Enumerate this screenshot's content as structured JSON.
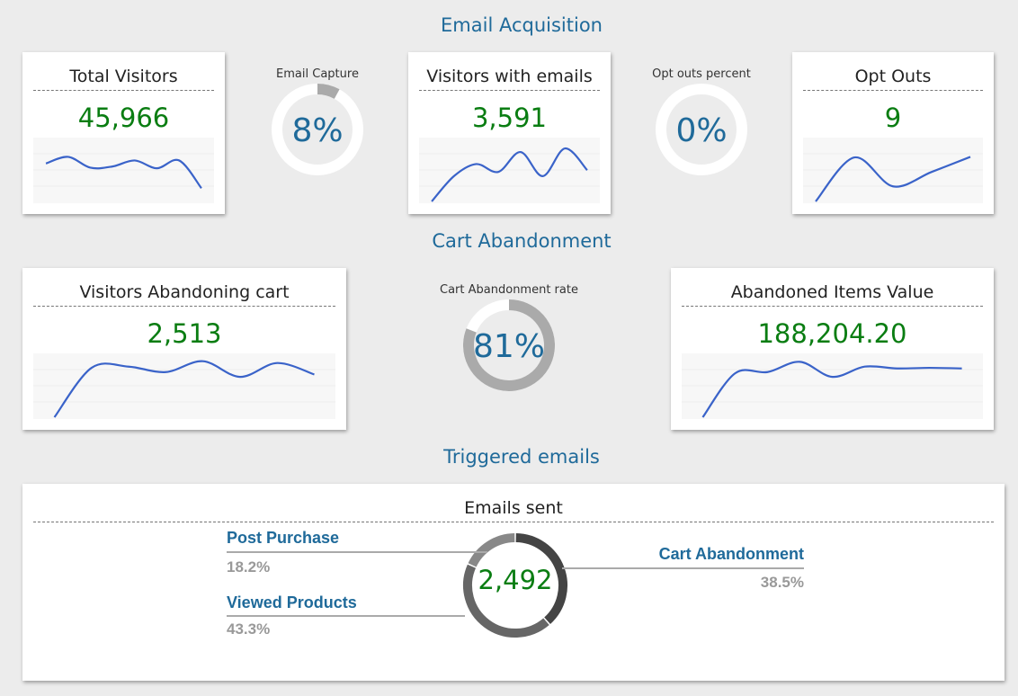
{
  "sections": {
    "email": "Email Acquisition",
    "cart": "Cart Abandonment",
    "triggered": "Triggered emails"
  },
  "cards": [
    {
      "title": "Total Visitors",
      "value": "45,966",
      "sparkline": [
        63,
        74,
        56,
        58,
        68,
        55,
        68,
        22
      ]
    },
    {
      "title": "Visitors with emails",
      "value": "3,591",
      "sparkline": [
        0,
        42,
        62,
        49,
        82,
        42,
        88,
        52
      ]
    },
    {
      "title": "Opt Outs",
      "value": "9",
      "sparkline": [
        0,
        73,
        25,
        49,
        74
      ]
    },
    {
      "title": "Visitors Abandoning cart",
      "value": "2,513",
      "sparkline": [
        0,
        82,
        84,
        75,
        93,
        67,
        90,
        71
      ]
    },
    {
      "title": "Abandoned Items Value",
      "value": "188,204.20",
      "sparkline": [
        0,
        73,
        75,
        92,
        67,
        84,
        81,
        82,
        81
      ]
    }
  ],
  "gauges": [
    {
      "label": "Email Capture",
      "value": "8%",
      "percent": 8
    },
    {
      "label": "Opt outs percent",
      "value": "0%",
      "percent": 0
    },
    {
      "label": "Cart Abandonment rate",
      "value": "81%",
      "percent": 81
    }
  ],
  "emails": {
    "title": "Emails sent",
    "total": "2,492",
    "segments": [
      {
        "name": "Cart Abandonment",
        "value": "38.5%",
        "percent": 38.5,
        "color": "#444444"
      },
      {
        "name": "Viewed Products",
        "value": "43.3%",
        "percent": 43.3,
        "color": "#666666"
      },
      {
        "name": "Post Purchase",
        "value": "18.2%",
        "percent": 18.2,
        "color": "#888888"
      }
    ]
  },
  "colors": {
    "accent": "#1f6a9a",
    "value": "#0a7d12",
    "line": "#3a63c9"
  }
}
